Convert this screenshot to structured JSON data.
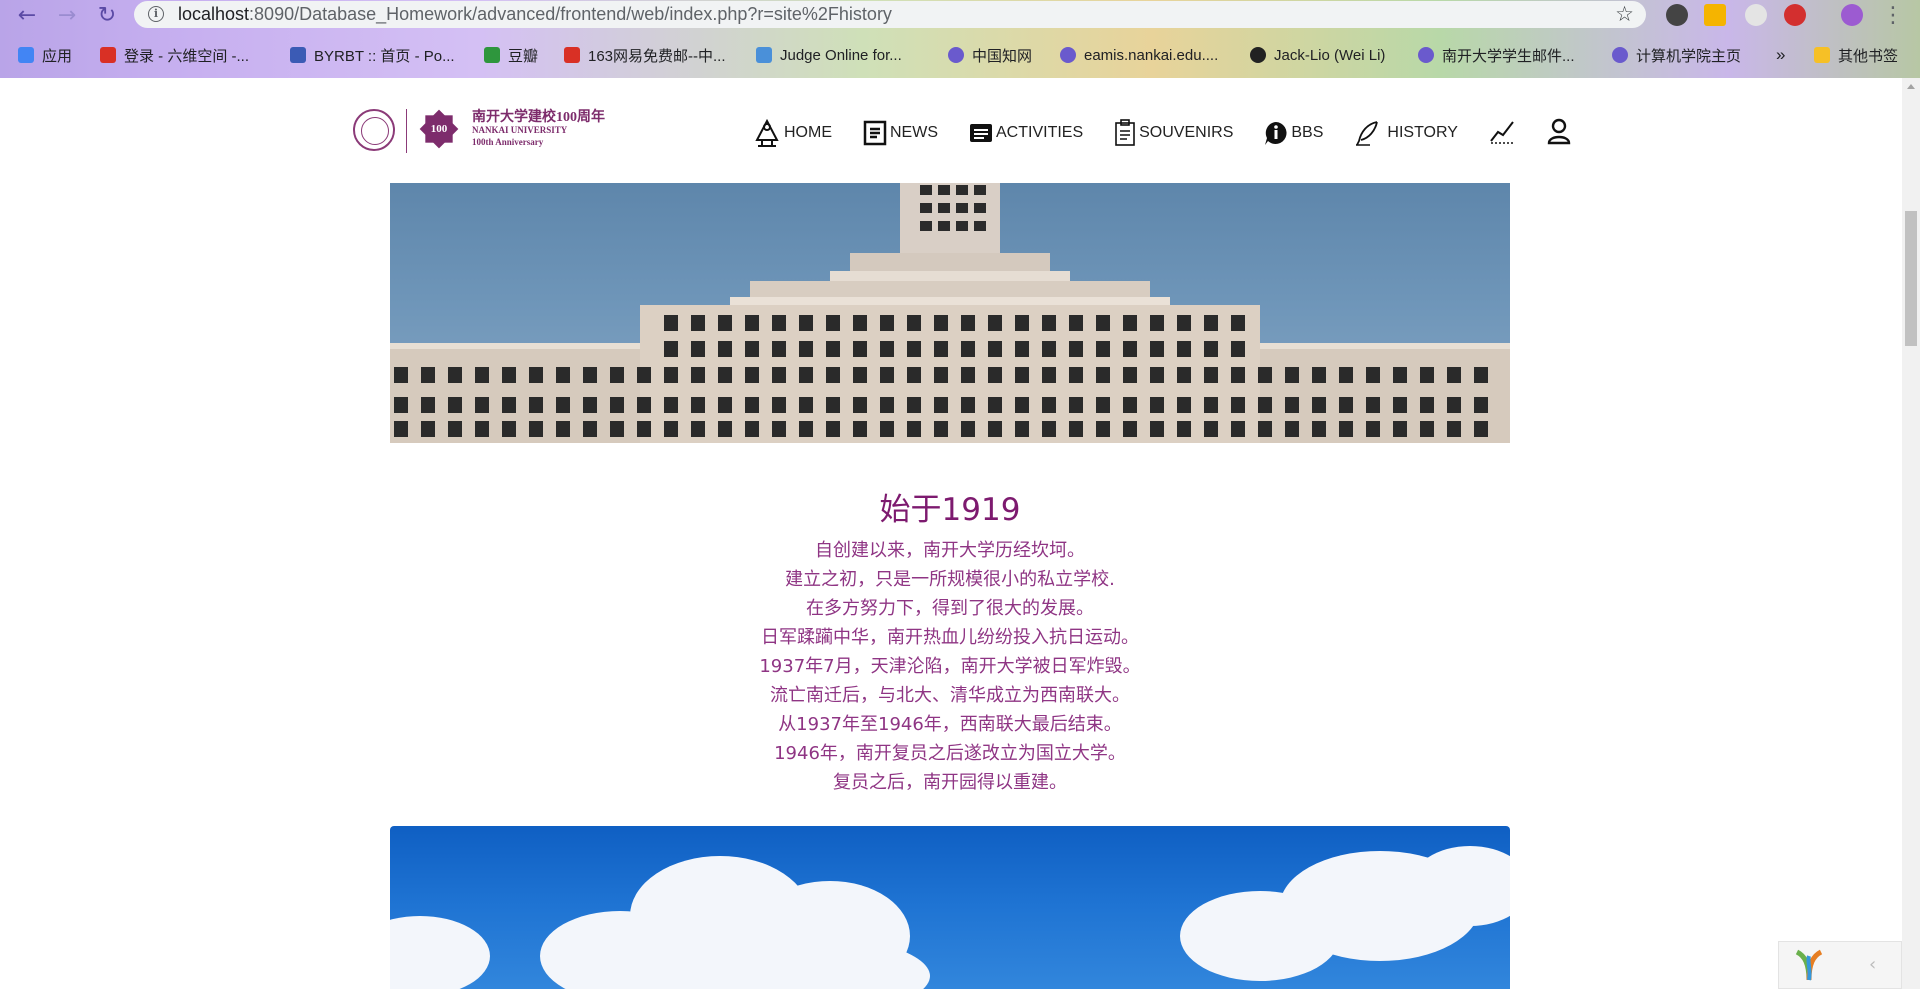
{
  "browser": {
    "url_host": "localhost",
    "url_rest": ":8090/Database_Homework/advanced/frontend/web/index.php?r=site%2Fhistory",
    "bookmarks": [
      {
        "label": "应用",
        "icon": "apps-grid-icon",
        "color": "#4285f4"
      },
      {
        "label": "登录 - 六维空间 -...",
        "icon": "6v-icon",
        "color": "#d93025"
      },
      {
        "label": "BYRBT :: 首页 - Po...",
        "icon": "byrbt-icon",
        "color": "#3b5bb5"
      },
      {
        "label": "豆瓣",
        "icon": "douban-icon",
        "color": "#2e963d"
      },
      {
        "label": "163网易免费邮--中...",
        "icon": "netease-icon",
        "color": "#d93025"
      },
      {
        "label": "Judge Online for...",
        "icon": "judge-icon",
        "color": "#4a90d9"
      },
      {
        "label": "中国知网",
        "icon": "globe-icon",
        "color": "#6a5acd"
      },
      {
        "label": "eamis.nankai.edu....",
        "icon": "globe-icon",
        "color": "#6a5acd"
      },
      {
        "label": "Jack-Lio (Wei Li)",
        "icon": "github-icon",
        "color": "#222222"
      },
      {
        "label": "南开大学学生邮件...",
        "icon": "globe-icon",
        "color": "#6a5acd"
      },
      {
        "label": "计算机学院主页",
        "icon": "globe-icon",
        "color": "#6a5acd"
      },
      {
        "label": "»",
        "icon": "more-bookmarks-icon",
        "color": "#202124"
      },
      {
        "label": "其他书签",
        "icon": "folder-icon",
        "color": "#f6c026"
      }
    ]
  },
  "site": {
    "logo_cn": "南开大学建校100周年",
    "logo_en1": "NANKAI UNIVERSITY",
    "logo_en2": "100th Anniversary",
    "logo_num": "100",
    "nav": {
      "home": "HOME",
      "news": "NEWS",
      "activities": "ACTIVITIES",
      "souvenirs": "SOUVENIRS",
      "bbs": "BBS",
      "history": "HISTORY"
    }
  },
  "history": {
    "title": "始于1919",
    "lines": [
      "自创建以来，南开大学历经坎坷。",
      "建立之初，只是一所规模很小的私立学校.",
      "在多方努力下，得到了很大的发展。",
      "日军蹂躏中华，南开热血儿纷纷投入抗日运动。",
      "1937年7月，天津沦陷，南开大学被日军炸毁。",
      "流亡南迁后，与北大、清华成立为西南联大。",
      "从1937年至1946年，西南联大最后结束。",
      "1946年，南开复员之后遂改立为国立大学。",
      "复员之后，南开园得以重建。"
    ]
  },
  "colors": {
    "accent": "#7d1a6f",
    "text": "#8f3584"
  }
}
